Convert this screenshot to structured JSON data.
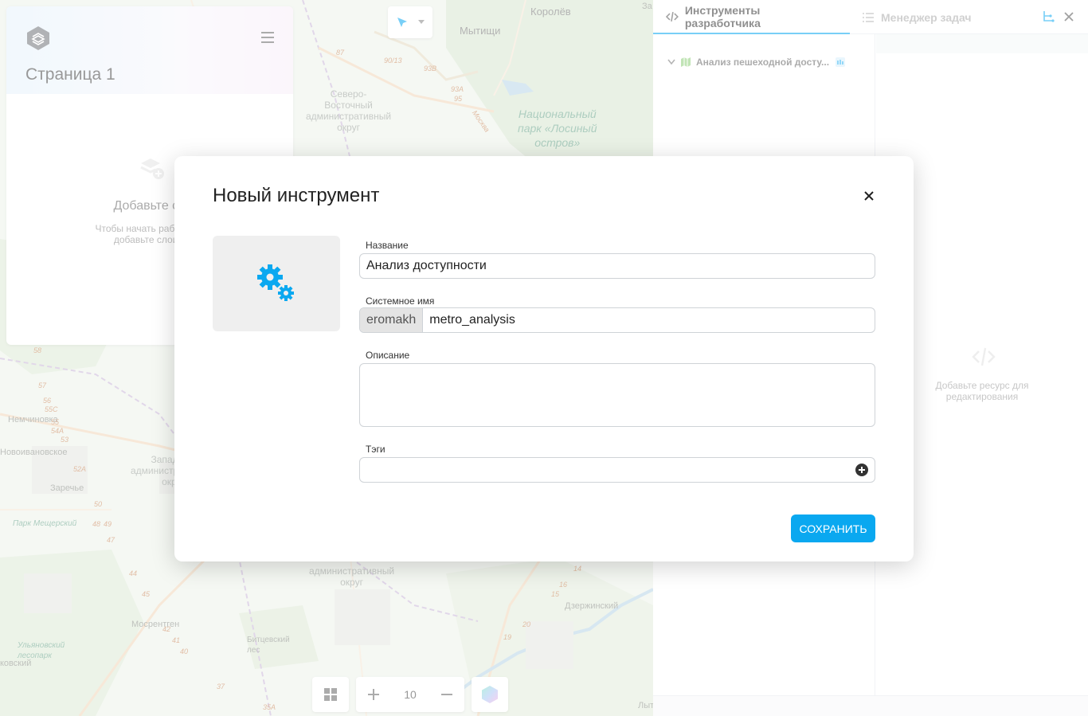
{
  "map": {
    "labels": {
      "korolev": "Королёв",
      "mytishchi": "Мытищи",
      "za": "За",
      "svao": "Северо-\nВосточный\nадминистративный\nокруг",
      "park_losiny": "Национальный\nпарк «Лосиный\nостров»",
      "nemchinovka": "Немчиновка",
      "novoivanovskoe": "Новоивановское",
      "zarechye": "Заречье",
      "park_meshchersky": "Парк Мещерский",
      "zao": "Западный\nадминистративный\nокруг",
      "uao": "административный\nокруг",
      "mosrentgen": "Мосрентген",
      "bitsevsky": "Битцевский\nлес",
      "ulyanovsky": "Ульяновский\nлесопарк",
      "kovsky": "ковский",
      "dzerzhinsky": "Дзержинский",
      "lyt": "Лыт",
      "moskva_river": "Москва",
      "n87": "87",
      "n90": "90/13",
      "n93b": "93В",
      "n93a": "93А",
      "n95": "95",
      "n58": "58",
      "n57": "57",
      "n56": "56",
      "n55c": "55С",
      "n55": "55",
      "n54a": "54А",
      "n53": "53",
      "n52a": "52А",
      "n50": "50",
      "n48": "48",
      "n49": "49",
      "n47": "47",
      "n44": "44",
      "n45": "45",
      "n42": "42",
      "n41": "41",
      "n40": "40",
      "n37": "37",
      "n35a": "35А",
      "n14": "14",
      "n16": "16",
      "n15": "15",
      "n20": "20",
      "n19": "19"
    }
  },
  "left_panel": {
    "page_title": "Страница 1",
    "empty_title": "Добавьте сл",
    "empty_sub": "Чтобы начать работу с п\nдобавьте слои в"
  },
  "dev_panel": {
    "tab_dev_tools": "Инструменты разработчика",
    "tab_task_manager": "Менеджер задач",
    "tree_item": "Анализ пешеходной досту...",
    "empty_resource": "Добавьте ресурс для\nредактирования"
  },
  "bottom": {
    "zoom_level": "10"
  },
  "modal": {
    "title": "Новый инструмент",
    "name_label": "Название",
    "name_value": "Анализ доступности",
    "sysname_label": "Системное имя",
    "sysname_prefix": "eromakh",
    "sysname_value": "metro_analysis",
    "description_label": "Описание",
    "description_value": "",
    "tags_label": "Тэги",
    "save_label": "СОХРАНИТЬ"
  },
  "colors": {
    "accent": "#0aa8f0",
    "gear": "#0aa8f0"
  }
}
